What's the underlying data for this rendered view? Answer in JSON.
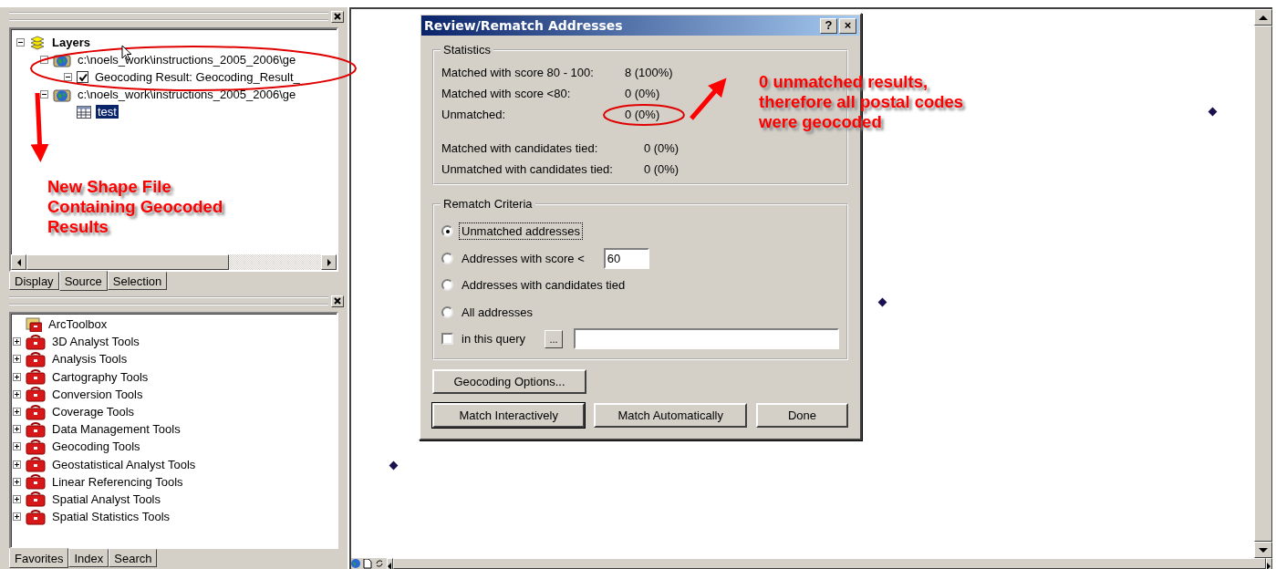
{
  "layers_panel": {
    "tree": [
      {
        "label": "Layers",
        "kind": "map",
        "expanded": true,
        "selected": false,
        "children": [
          {
            "label": "c:\\noels_work\\instructions_2005_2006\\ge",
            "kind": "dataframe",
            "expanded": true,
            "selected": false,
            "children": [
              {
                "label": "Geocoding Result: Geocoding_Result_",
                "kind": "layer",
                "expanded": true,
                "checked": true,
                "selected": false
              }
            ]
          },
          {
            "label": "c:\\noels_work\\instructions_2005_2006\\ge",
            "kind": "dataframe",
            "expanded": true,
            "selected": false,
            "children": [
              {
                "label": "test",
                "kind": "table",
                "selected": true
              }
            ]
          }
        ]
      }
    ],
    "tabs": [
      {
        "label": "Display",
        "selected": false
      },
      {
        "label": "Source",
        "selected": true
      },
      {
        "label": "Selection",
        "selected": false
      }
    ]
  },
  "toolbox_panel": {
    "tree": [
      {
        "label": "ArcToolbox",
        "kind": "toolbox",
        "children": [
          {
            "label": "3D Analyst Tools",
            "kind": "toolset",
            "expanded": false
          },
          {
            "label": "Analysis Tools",
            "kind": "toolset",
            "expanded": false
          },
          {
            "label": "Cartography Tools",
            "kind": "toolset",
            "expanded": false
          },
          {
            "label": "Conversion Tools",
            "kind": "toolset",
            "expanded": false
          },
          {
            "label": "Coverage Tools",
            "kind": "toolset",
            "expanded": false
          },
          {
            "label": "Data Management Tools",
            "kind": "toolset",
            "expanded": false
          },
          {
            "label": "Geocoding Tools",
            "kind": "toolset",
            "expanded": false
          },
          {
            "label": "Geostatistical Analyst Tools",
            "kind": "toolset",
            "expanded": false
          },
          {
            "label": "Linear Referencing Tools",
            "kind": "toolset",
            "expanded": false
          },
          {
            "label": "Spatial Analyst Tools",
            "kind": "toolset",
            "expanded": false
          },
          {
            "label": "Spatial Statistics Tools",
            "kind": "toolset",
            "expanded": false
          }
        ]
      }
    ],
    "tabs": [
      {
        "label": "Favorites",
        "selected": true
      },
      {
        "label": "Index",
        "selected": false
      },
      {
        "label": "Search",
        "selected": false
      }
    ]
  },
  "dialog": {
    "title": "Review/Rematch Addresses",
    "help": "?",
    "close": "×",
    "statistics": {
      "legend": "Statistics",
      "groups": [
        [
          {
            "label": "Matched with score 80 - 100:",
            "value": "8  (100%)"
          },
          {
            "label": "Matched with score <80:",
            "value": "0  (0%)"
          },
          {
            "label": "Unmatched:",
            "value": "0  (0%)"
          }
        ],
        [
          {
            "label": "Matched with candidates tied:",
            "value": "0  (0%)"
          },
          {
            "label": "Unmatched with candidates tied:",
            "value": "0  (0%)"
          }
        ]
      ]
    },
    "rematch": {
      "legend": "Rematch Criteria",
      "options": [
        {
          "kind": "radio",
          "label": "Unmatched addresses",
          "selected": true
        },
        {
          "kind": "score",
          "label": "Addresses with score <",
          "selected": false,
          "value": "60"
        },
        {
          "kind": "radio",
          "label": "Addresses with candidates tied",
          "selected": false
        },
        {
          "kind": "radio",
          "label": "All addresses",
          "selected": false
        },
        {
          "kind": "query",
          "label": "in this query",
          "checked": false,
          "browse": "..."
        }
      ]
    },
    "options_button": "Geocoding Options...",
    "buttons": [
      {
        "label": "Match Interactively",
        "default": true
      },
      {
        "label": "Match Automatically",
        "default": false
      },
      {
        "label": "Done",
        "default": false
      }
    ]
  },
  "annotations": [
    {
      "kind": "note",
      "lines": [
        "New Shape File",
        "Containing Geocoded",
        "Results"
      ]
    },
    {
      "kind": "note",
      "lines": [
        "0 unmatched results,",
        "therefore all postal codes",
        "were geocoded"
      ]
    }
  ]
}
